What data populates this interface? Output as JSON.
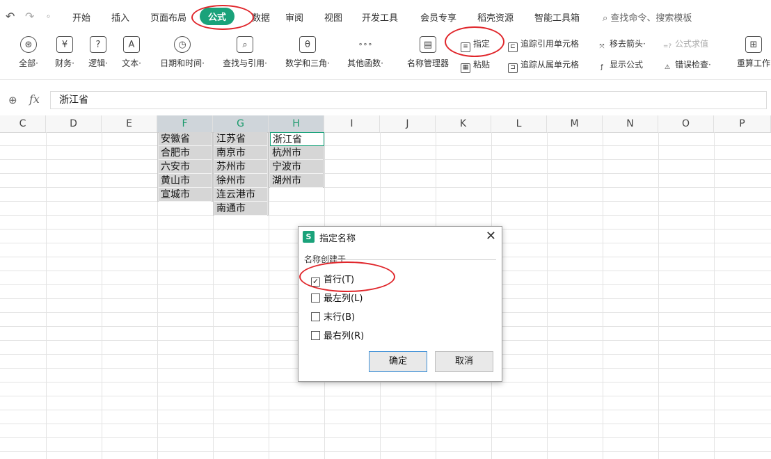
{
  "quick_access": {
    "undo_icon": "↶",
    "redo_icon": "↷",
    "more_icon": "◦"
  },
  "menu": {
    "items": [
      "开始",
      "插入",
      "页面布局",
      "公式",
      "数据",
      "审阅",
      "视图",
      "开发工具",
      "会员专享",
      "稻壳资源",
      "智能工具箱"
    ],
    "active": "公式",
    "search": "查找命令、搜索模板"
  },
  "ribbon": {
    "groups": [
      {
        "label": "全部·",
        "icon": "⊛"
      },
      {
        "label": "财务·",
        "icon": "¥"
      },
      {
        "label": "逻辑·",
        "icon": "?"
      },
      {
        "label": "文本·",
        "icon": "A"
      },
      {
        "label": "日期和时间·",
        "icon": "◷"
      },
      {
        "label": "查找与引用·",
        "icon": "⌕"
      },
      {
        "label": "数学和三角·",
        "icon": "θ"
      },
      {
        "label": "其他函数·",
        "icon": "∘∘∘"
      }
    ],
    "name_manager": "名称管理器",
    "specify": "指定",
    "paste": "粘贴",
    "trace_precedents": "追踪引用单元格",
    "trace_dependents": "追踪从属单元格",
    "remove_arrows": "移去箭头·",
    "show_formulas": "显示公式",
    "eval_formula": "公式求值",
    "error_check": "错误检查·",
    "recalc": "重算工作"
  },
  "formula_bar": {
    "fx": "fx",
    "value": "浙江省"
  },
  "columns": [
    "C",
    "D",
    "E",
    "F",
    "G",
    "H",
    "I",
    "J",
    "K",
    "L",
    "M",
    "N",
    "O",
    "P"
  ],
  "cells": {
    "F": [
      "安徽省",
      "合肥市",
      "六安市",
      "黄山市",
      "宣城市"
    ],
    "G": [
      "江苏省",
      "南京市",
      "苏州市",
      "徐州市",
      "连云港市",
      "南通市"
    ],
    "H": [
      "浙江省",
      "杭州市",
      "宁波市",
      "湖州市"
    ]
  },
  "dialog": {
    "title": "指定名称",
    "group_label": "名称创建于",
    "options": [
      {
        "label": "首行(T)",
        "checked": true
      },
      {
        "label": "最左列(L)",
        "checked": false
      },
      {
        "label": "末行(B)",
        "checked": false
      },
      {
        "label": "最右列(R)",
        "checked": false
      }
    ],
    "ok": "确定",
    "cancel": "取消"
  },
  "colors": {
    "accent": "#1aa27a",
    "annotation": "#e0262b"
  }
}
